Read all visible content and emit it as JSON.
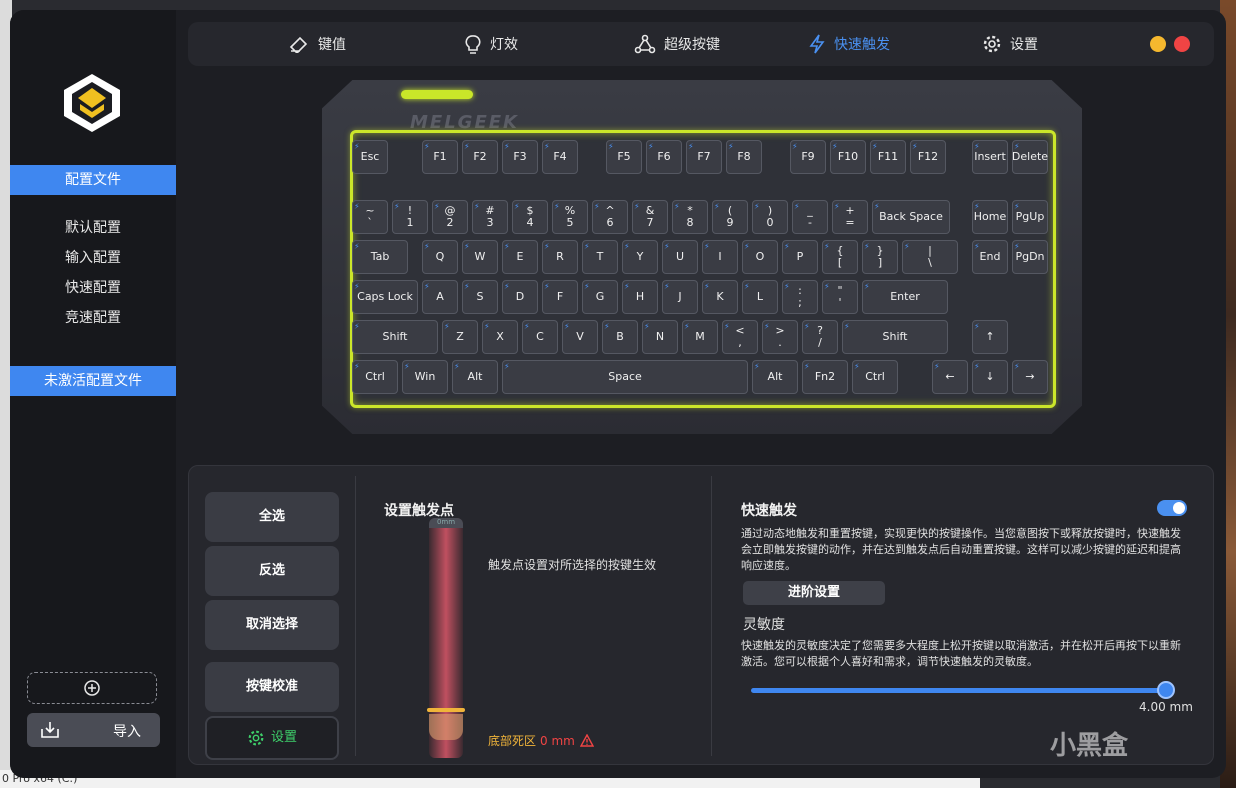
{
  "nav": {
    "items": [
      {
        "label": "键值",
        "icon": "key-value-icon"
      },
      {
        "label": "灯效",
        "icon": "bulb-icon"
      },
      {
        "label": "超级按键",
        "icon": "super-key-icon"
      },
      {
        "label": "快速触发",
        "icon": "lightning-icon",
        "active": true
      },
      {
        "label": "设置",
        "icon": "gear-icon"
      }
    ],
    "colors": {
      "accent": "#4a90f0",
      "minimize": "#f5b82e",
      "close": "#f04444"
    }
  },
  "sidebar": {
    "profiles_label": "配置文件",
    "items": [
      "默认配置",
      "输入配置",
      "快速配置",
      "竞速配置"
    ],
    "inactive_label": "未激活配置文件",
    "import_label": "导入"
  },
  "keyboard": {
    "brand": "MELGEEK",
    "led_color": "#cbe62a",
    "rows": [
      [
        "Esc",
        "F1",
        "F2",
        "F3",
        "F4",
        "F5",
        "F6",
        "F7",
        "F8",
        "F9",
        "F10",
        "F11",
        "F12",
        "Insert",
        "Delete"
      ],
      [
        "~\n`",
        "!\n1",
        "@\n2",
        "#\n3",
        "$\n4",
        "%\n5",
        "^\n6",
        "&\n7",
        "*\n8",
        "(\n9",
        ")\n0",
        "_\n-",
        "+\n=",
        "Back Space",
        "Home",
        "PgUp"
      ],
      [
        "Tab",
        "Q",
        "W",
        "E",
        "R",
        "T",
        "Y",
        "U",
        "I",
        "O",
        "P",
        "{\n[",
        "}\n]",
        "|\n\\",
        "End",
        "PgDn"
      ],
      [
        "Caps Lock",
        "A",
        "S",
        "D",
        "F",
        "G",
        "H",
        "J",
        "K",
        "L",
        ":\n;",
        "\"\n'",
        "Enter"
      ],
      [
        "Shift",
        "Z",
        "X",
        "C",
        "V",
        "B",
        "N",
        "M",
        "<\n,",
        ">\n.",
        "?\n/",
        "Shift",
        "↑"
      ],
      [
        "Ctrl",
        "Win",
        "Alt",
        "Space",
        "Alt",
        "Fn2",
        "Ctrl",
        "←",
        "↓",
        "→"
      ]
    ]
  },
  "panel": {
    "buttons": {
      "select_all": "全选",
      "invert": "反选",
      "deselect": "取消选择",
      "calibrate": "按键校准",
      "settings": "设置"
    },
    "trigger": {
      "title": "设置触发点",
      "desc": "触发点设置对所选择的按键生效",
      "slider_cap": "0mm",
      "deadzone_label": "底部死区",
      "deadzone_value": "0 mm"
    },
    "rapid": {
      "title": "快速触发",
      "enabled": true,
      "desc": "通过动态地触发和重置按键，实现更快的按键操作。当您意图按下或释放按键时，快速触发会立即触发按键的动作，并在达到触发点后自动重置按键。这样可以减少按键的延迟和提高响应速度。",
      "advanced_label": "进阶设置",
      "sensitivity_title": "灵敏度",
      "sensitivity_desc": "快速触发的灵敏度决定了您需要多大程度上松开按键以取消激活，并在松开后再按下以重新激活。您可以根据个人喜好和需求，调节快速触发的灵敏度。",
      "sensitivity_value": "4.00 mm",
      "sensitivity_fraction": 1.0
    }
  },
  "desktop": {
    "taskbar_text": "0 Pro x64 (C:)"
  },
  "watermark": "小黑盒"
}
